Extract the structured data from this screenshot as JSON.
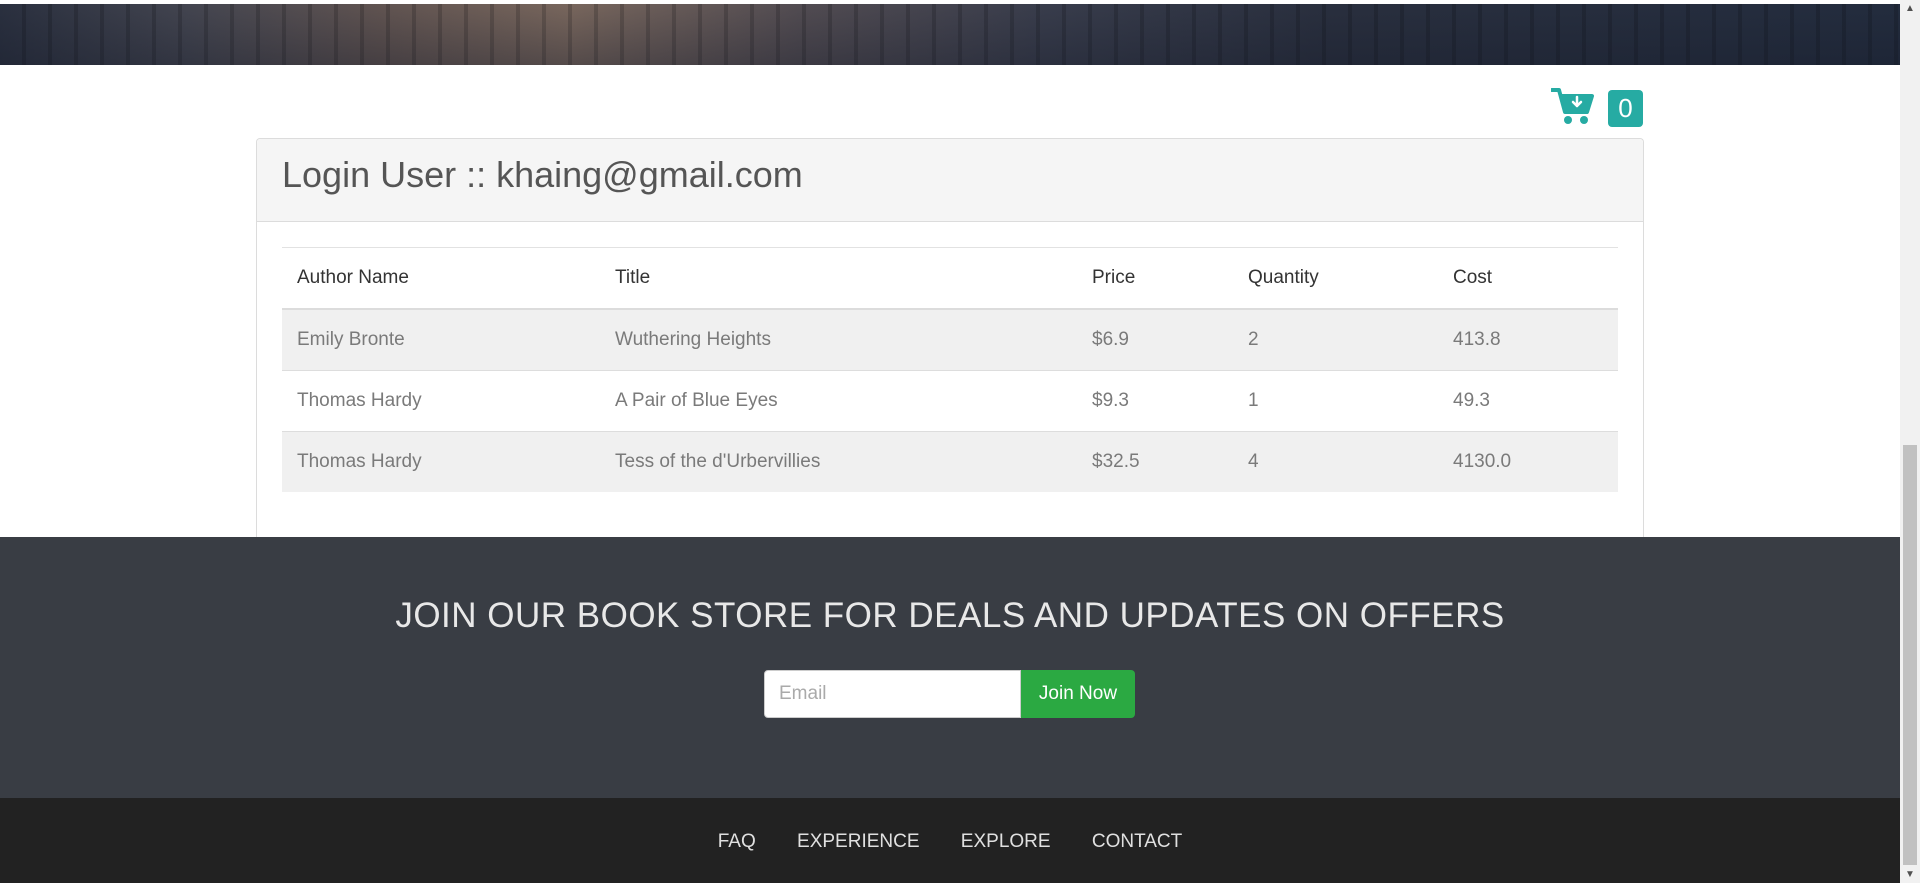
{
  "cart": {
    "icon": "cart-download-icon",
    "count": "0",
    "accent": "#26aba3"
  },
  "panel": {
    "title": "Login User :: khaing@gmail.com",
    "columns": [
      "Author Name",
      "Title",
      "Price",
      "Quantity",
      "Cost"
    ],
    "rows": [
      [
        "Emily Bronte",
        "Wuthering Heights",
        "$6.9",
        "2",
        "413.8"
      ],
      [
        "Thomas Hardy",
        "A Pair of Blue Eyes",
        "$9.3",
        "1",
        "49.3"
      ],
      [
        "Thomas Hardy",
        "Tess of the d'Urbervillies",
        "$32.5",
        "4",
        "4130.0"
      ]
    ]
  },
  "newsletter": {
    "heading": "JOIN OUR BOOK STORE FOR DEALS AND UPDATES ON OFFERS",
    "email_placeholder": "Email",
    "join_label": "Join Now",
    "button_color": "#2ba942"
  },
  "footer": {
    "links": [
      "FAQ",
      "EXPERIENCE",
      "EXPLORE",
      "CONTACT"
    ]
  }
}
